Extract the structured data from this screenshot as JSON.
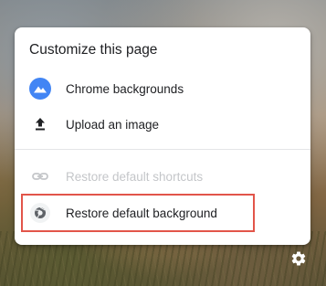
{
  "menu": {
    "title": "Customize this page",
    "items": [
      {
        "label": "Chrome backgrounds",
        "icon": "chrome-backgrounds-icon",
        "disabled": false
      },
      {
        "label": "Upload an image",
        "icon": "upload-icon",
        "disabled": false
      },
      {
        "label": "Restore default shortcuts",
        "icon": "link-icon",
        "disabled": true
      },
      {
        "label": "Restore default background",
        "icon": "chrome-logo-icon",
        "disabled": false
      }
    ]
  },
  "colors": {
    "accent_blue": "#4285f4",
    "highlight_red": "#e2554a",
    "disabled_text": "#c4c6c9"
  },
  "settings_icon": "gear-icon"
}
